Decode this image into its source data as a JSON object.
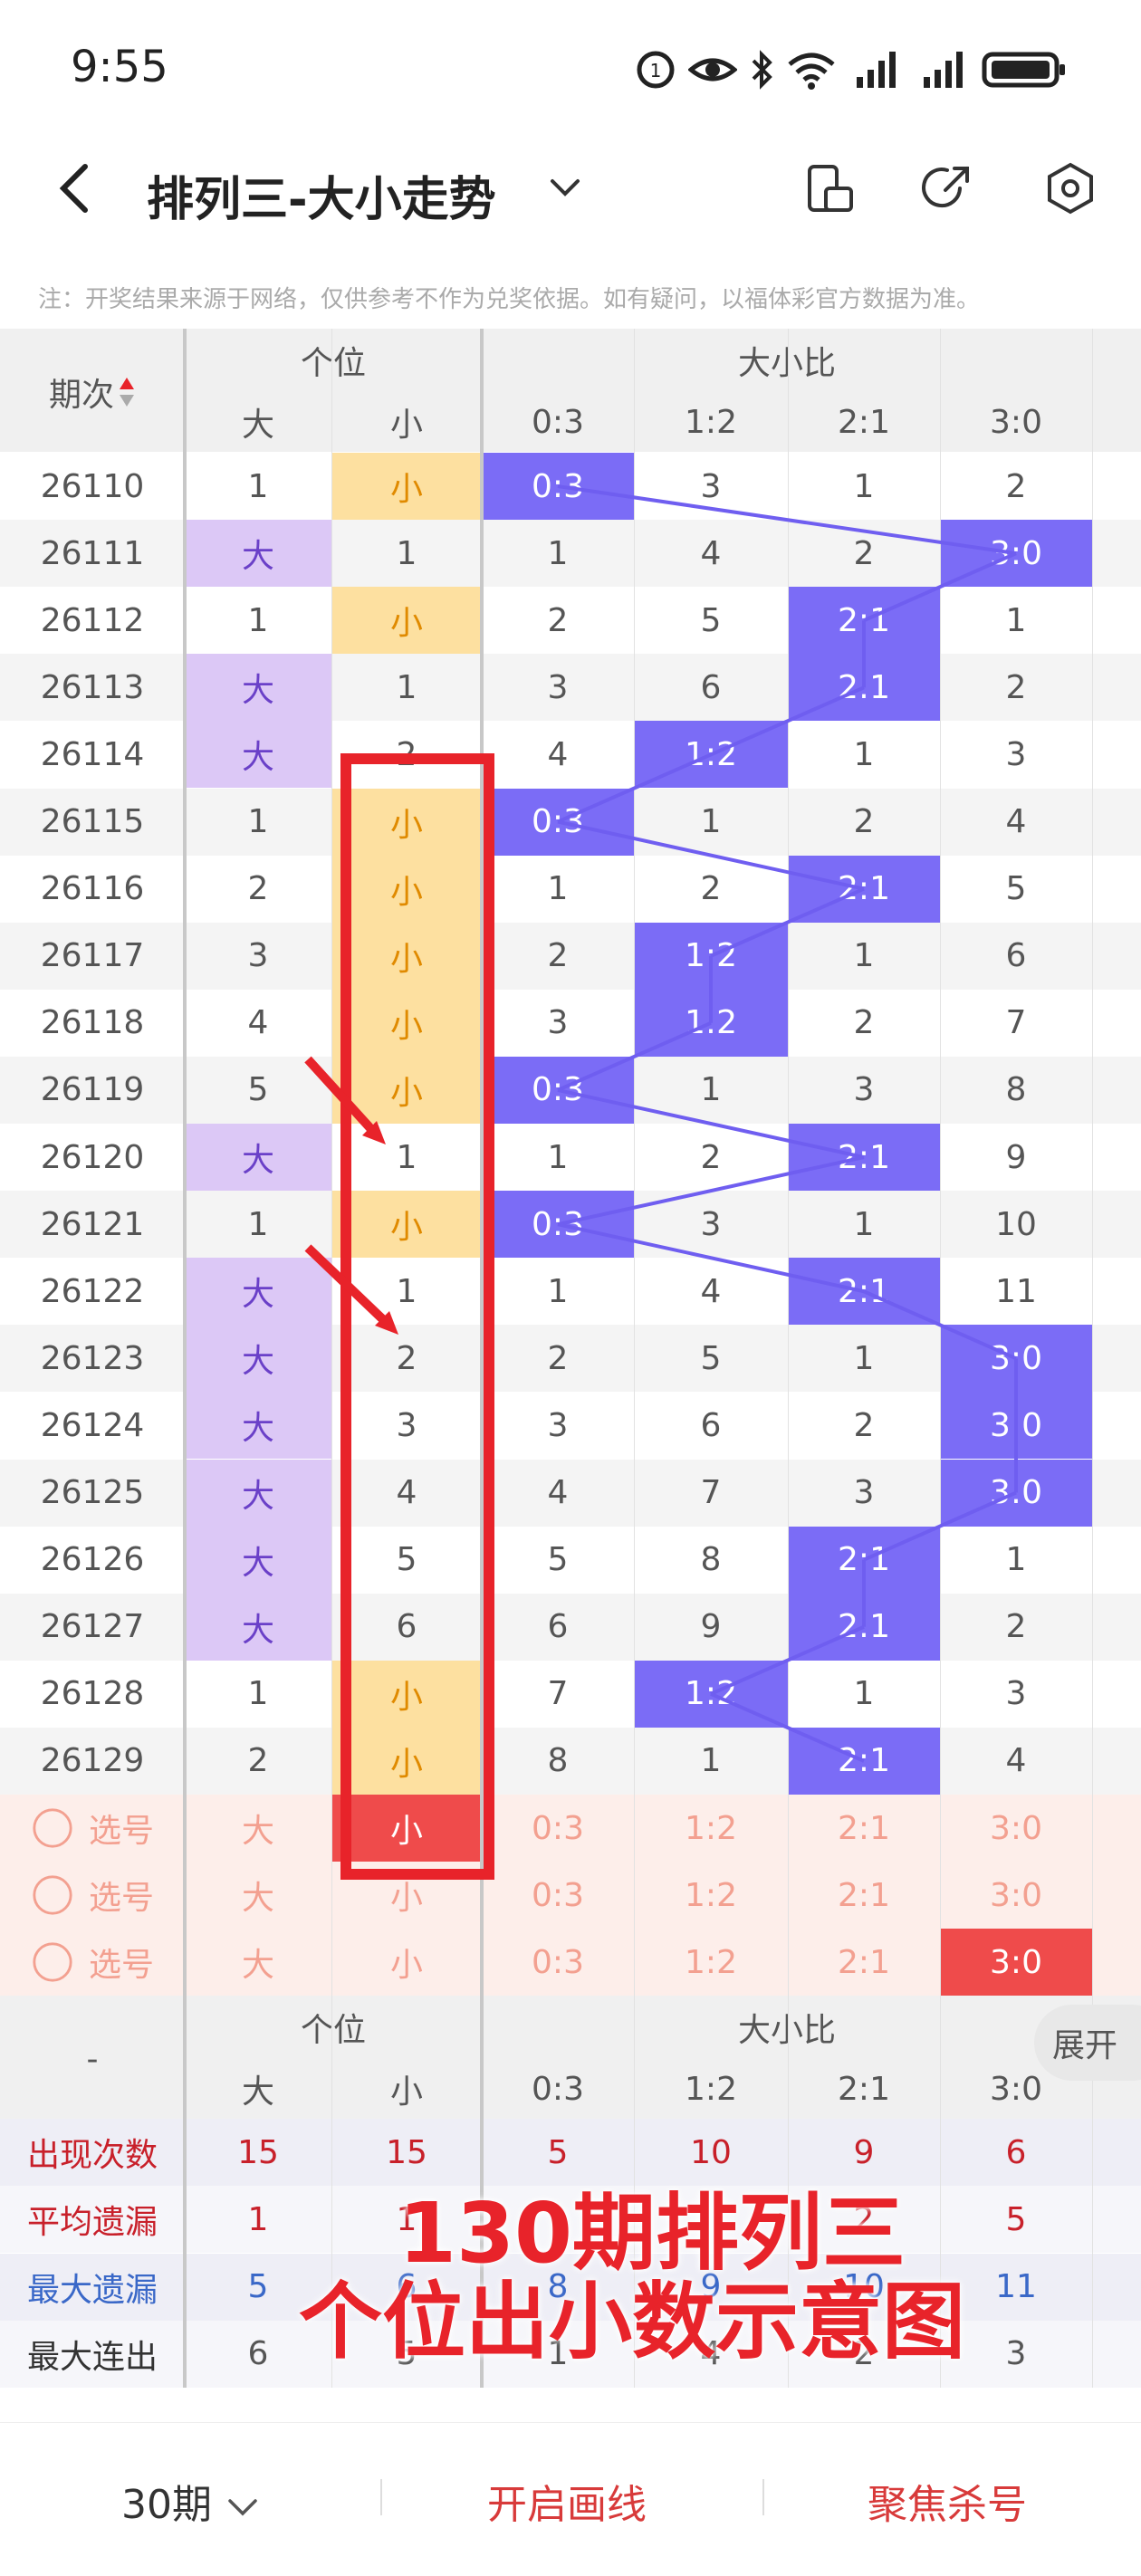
{
  "status_bar": {
    "time": "9:55",
    "icons": [
      "data-saver-icon",
      "eye-icon",
      "bluetooth-icon",
      "wifi-icon",
      "signal-icon",
      "signal-icon",
      "battery-icon"
    ]
  },
  "header": {
    "title": "排列三-大小走势",
    "icons": [
      "back-icon",
      "chevron-down-icon",
      "phone-rotate-icon",
      "share-icon",
      "settings-hex-icon"
    ]
  },
  "notice": "注：开奖结果来源于网络，仅供参考不作为兑奖依据。如有疑问，以福体彩官方数据为准。",
  "table": {
    "period_header": "期次",
    "group1_header": "个位",
    "group1_cols": [
      "大",
      "小"
    ],
    "group2_header": "大小比",
    "group2_cols": [
      "0:3",
      "1:2",
      "2:1",
      "3:0"
    ],
    "rows": [
      {
        "period": "26110",
        "da": "1",
        "xiao": "小",
        "r": [
          "0:3",
          "3",
          "1",
          "2"
        ],
        "hit": 0,
        "fill": "xiao"
      },
      {
        "period": "26111",
        "da": "大",
        "xiao": "1",
        "r": [
          "1",
          "4",
          "2",
          "3:0"
        ],
        "hit": 3,
        "fill": "da"
      },
      {
        "period": "26112",
        "da": "1",
        "xiao": "小",
        "r": [
          "2",
          "5",
          "2:1",
          "1"
        ],
        "hit": 2,
        "fill": "xiao"
      },
      {
        "period": "26113",
        "da": "大",
        "xiao": "1",
        "r": [
          "3",
          "6",
          "2:1",
          "2"
        ],
        "hit": 2,
        "fill": "da"
      },
      {
        "period": "26114",
        "da": "大",
        "xiao": "2",
        "r": [
          "4",
          "1:2",
          "1",
          "3"
        ],
        "hit": 1,
        "fill": "da"
      },
      {
        "period": "26115",
        "da": "1",
        "xiao": "小",
        "r": [
          "0:3",
          "1",
          "2",
          "4"
        ],
        "hit": 0,
        "fill": "xiao"
      },
      {
        "period": "26116",
        "da": "2",
        "xiao": "小",
        "r": [
          "1",
          "2",
          "2:1",
          "5"
        ],
        "hit": 2,
        "fill": "xiao"
      },
      {
        "period": "26117",
        "da": "3",
        "xiao": "小",
        "r": [
          "2",
          "1:2",
          "1",
          "6"
        ],
        "hit": 1,
        "fill": "xiao"
      },
      {
        "period": "26118",
        "da": "4",
        "xiao": "小",
        "r": [
          "3",
          "1:2",
          "2",
          "7"
        ],
        "hit": 1,
        "fill": "xiao"
      },
      {
        "period": "26119",
        "da": "5",
        "xiao": "小",
        "r": [
          "0:3",
          "1",
          "3",
          "8"
        ],
        "hit": 0,
        "fill": "xiao"
      },
      {
        "period": "26120",
        "da": "大",
        "xiao": "1",
        "r": [
          "1",
          "2",
          "2:1",
          "9"
        ],
        "hit": 2,
        "fill": "da"
      },
      {
        "period": "26121",
        "da": "1",
        "xiao": "小",
        "r": [
          "0:3",
          "3",
          "1",
          "10"
        ],
        "hit": 0,
        "fill": "xiao"
      },
      {
        "period": "26122",
        "da": "大",
        "xiao": "1",
        "r": [
          "1",
          "4",
          "2:1",
          "11"
        ],
        "hit": 2,
        "fill": "da"
      },
      {
        "period": "26123",
        "da": "大",
        "xiao": "2",
        "r": [
          "2",
          "5",
          "1",
          "3:0"
        ],
        "hit": 3,
        "fill": "da"
      },
      {
        "period": "26124",
        "da": "大",
        "xiao": "3",
        "r": [
          "3",
          "6",
          "2",
          "3:0"
        ],
        "hit": 3,
        "fill": "da"
      },
      {
        "period": "26125",
        "da": "大",
        "xiao": "4",
        "r": [
          "4",
          "7",
          "3",
          "3:0"
        ],
        "hit": 3,
        "fill": "da"
      },
      {
        "period": "26126",
        "da": "大",
        "xiao": "5",
        "r": [
          "5",
          "8",
          "2:1",
          "1"
        ],
        "hit": 2,
        "fill": "da"
      },
      {
        "period": "26127",
        "da": "大",
        "xiao": "6",
        "r": [
          "6",
          "9",
          "2:1",
          "2"
        ],
        "hit": 2,
        "fill": "da"
      },
      {
        "period": "26128",
        "da": "1",
        "xiao": "小",
        "r": [
          "7",
          "1:2",
          "1",
          "3"
        ],
        "hit": 1,
        "fill": "xiao"
      },
      {
        "period": "26129",
        "da": "2",
        "xiao": "小",
        "r": [
          "8",
          "1",
          "2:1",
          "4"
        ],
        "hit": 2,
        "fill": "xiao"
      }
    ],
    "select_rows": [
      {
        "label": "选号",
        "da": "大",
        "xiao": "小",
        "r": [
          "0:3",
          "1:2",
          "2:1",
          "3:0"
        ],
        "xiao_selected": true,
        "r_selected": -1
      },
      {
        "label": "选号",
        "da": "大",
        "xiao": "小",
        "r": [
          "0:3",
          "1:2",
          "2:1",
          "3:0"
        ],
        "xiao_selected": false,
        "r_selected": -1
      },
      {
        "label": "选号",
        "da": "大",
        "xiao": "小",
        "r": [
          "0:3",
          "1:2",
          "2:1",
          "3:0"
        ],
        "xiao_selected": false,
        "r_selected": 3
      }
    ],
    "footer_dash": "-",
    "stats": [
      {
        "label": "出现次数",
        "values": [
          "15",
          "15",
          "5",
          "10",
          "9",
          "6"
        ],
        "style": "red"
      },
      {
        "label": "平均遗漏",
        "values": [
          "1",
          "1",
          "",
          "",
          "2",
          "5"
        ],
        "style": "dark-red"
      },
      {
        "label": "最大遗漏",
        "values": [
          "5",
          "6",
          "8",
          "9",
          "10",
          "11"
        ],
        "style": "blue"
      },
      {
        "label": "最大连出",
        "values": [
          "6",
          "5",
          "1",
          "4",
          "2",
          "3"
        ],
        "style": "dark"
      }
    ]
  },
  "expand_label": "展开",
  "annotation": {
    "line1": "130期排列三",
    "line2": "个位出小数示意图"
  },
  "bottom_bar": {
    "period": "30期",
    "draw": "开启画线",
    "focus": "聚焦杀号"
  },
  "colors": {
    "purple_fill": "#dcc8f6",
    "yellow_fill": "#fde0a0",
    "blue_fill": "#7b6cf6",
    "red": "#e8232a"
  }
}
